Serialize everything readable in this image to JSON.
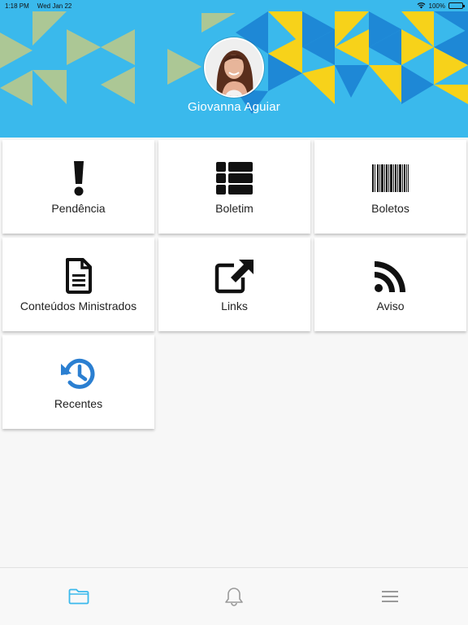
{
  "status_bar": {
    "time": "1:18 PM",
    "date": "Wed Jan 22",
    "battery": "100%",
    "wifi_icon": "wifi-icon",
    "battery_icon": "battery-icon"
  },
  "header": {
    "user_name": "Giovanna Aguiar",
    "colors": {
      "background": "#3ab9ec",
      "yellow": "#f7d21a",
      "blue": "#1e88d6",
      "olive": "#b8c98a"
    }
  },
  "tiles": [
    {
      "label": "Pendência",
      "icon": "exclamation-icon"
    },
    {
      "label": "Boletim",
      "icon": "list-grid-icon"
    },
    {
      "label": "Boletos",
      "icon": "barcode-icon"
    },
    {
      "label": "Conteúdos Ministrados",
      "icon": "document-icon"
    },
    {
      "label": "Links",
      "icon": "external-link-icon"
    },
    {
      "label": "Aviso",
      "icon": "rss-icon"
    },
    {
      "label": "Recentes",
      "icon": "history-icon",
      "icon_color": "#2b7fd1"
    }
  ],
  "bottom_nav": {
    "items": [
      {
        "icon": "folder-icon",
        "active": true,
        "color": "#3ab9ec"
      },
      {
        "icon": "bell-icon",
        "active": false,
        "color": "#9a9a9a"
      },
      {
        "icon": "menu-icon",
        "active": false,
        "color": "#9a9a9a"
      }
    ]
  }
}
